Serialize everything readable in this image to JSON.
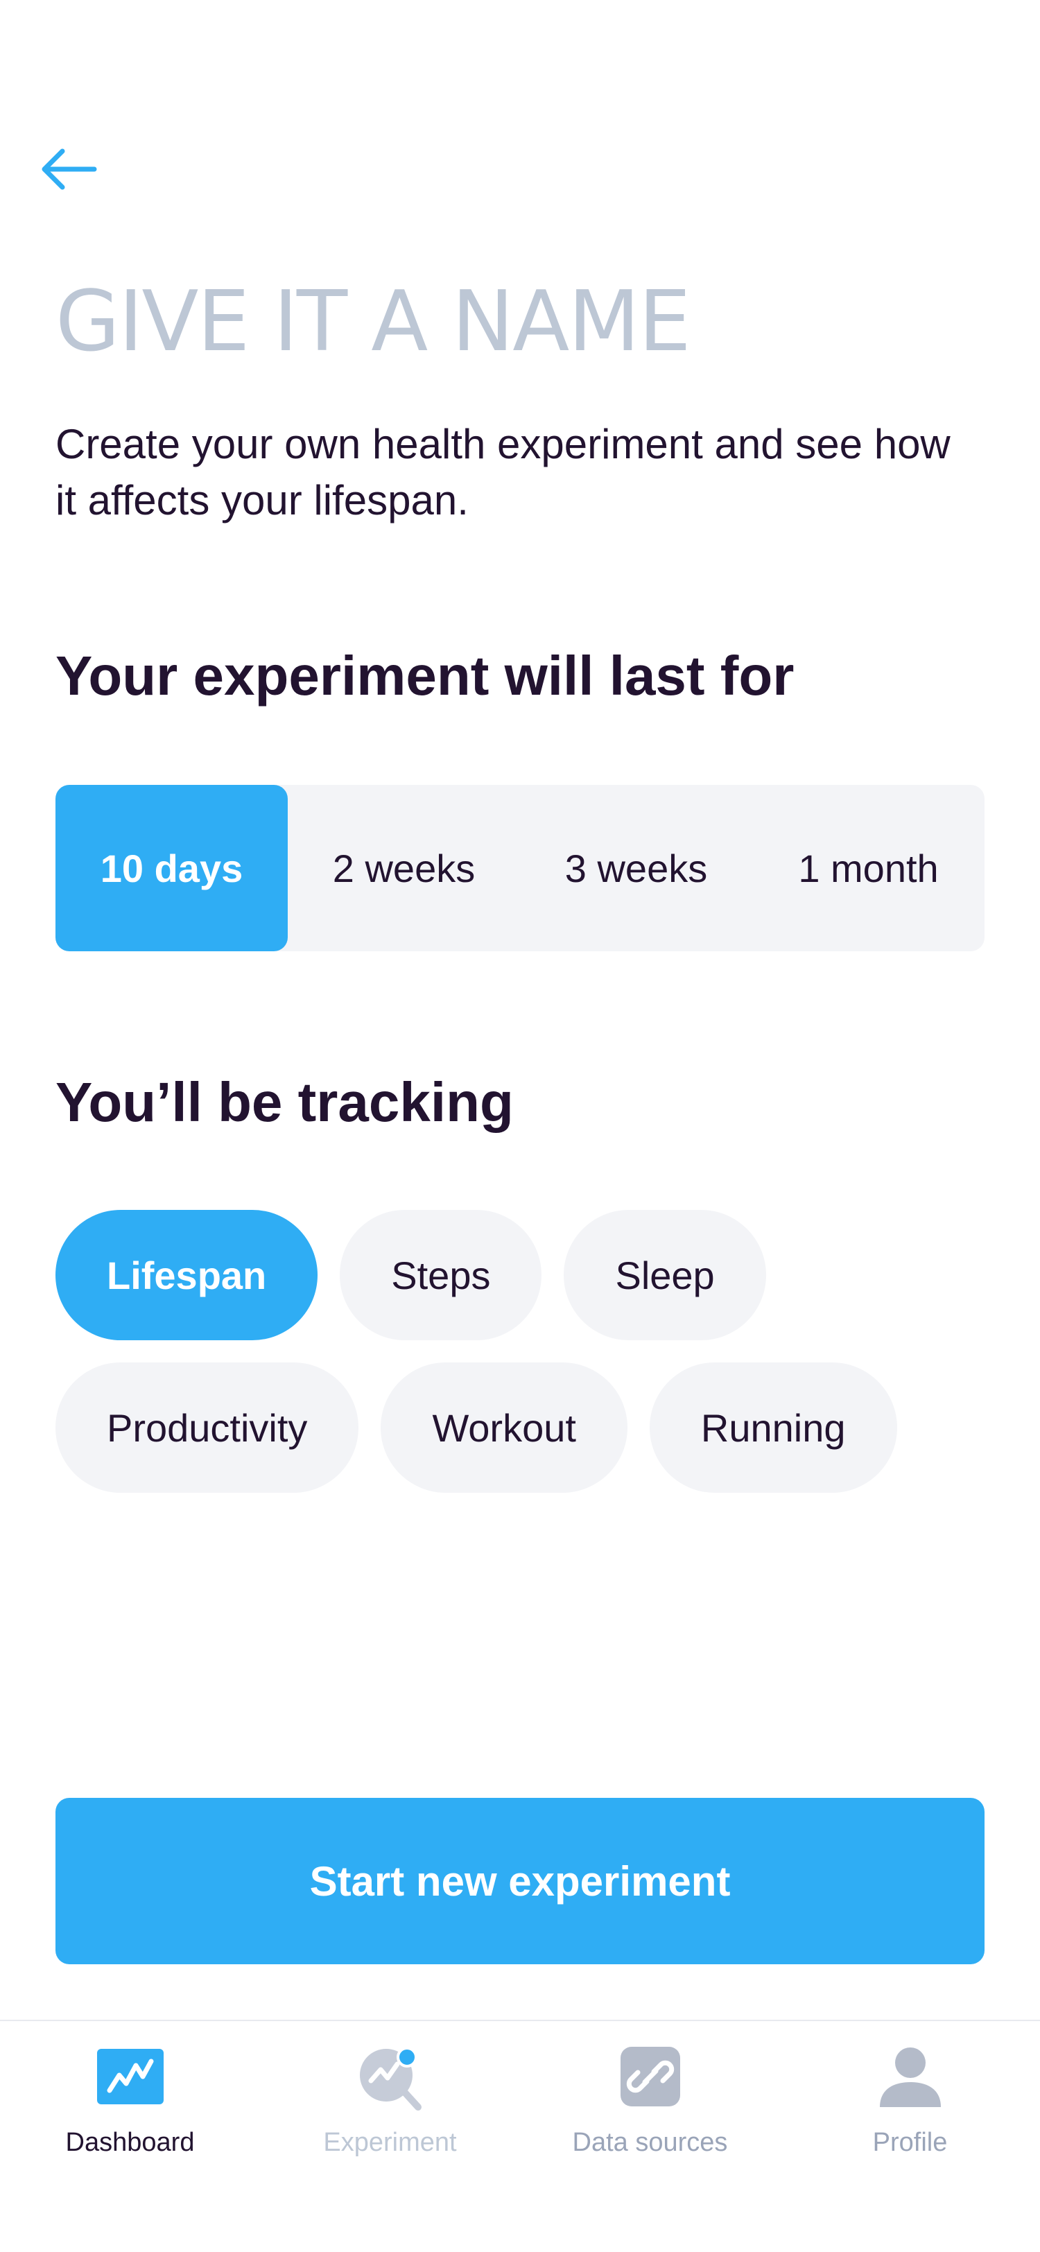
{
  "header": {
    "title": "GIVE IT A NAME",
    "subtitle": "Create your own health experiment and see how it affects your lifespan."
  },
  "duration": {
    "heading": "Your experiment will last for",
    "options": [
      "10 days",
      "2 weeks",
      "3 weeks",
      "1 month"
    ],
    "selected": "10 days"
  },
  "tracking": {
    "heading": "You’ll be tracking",
    "options": [
      "Lifespan",
      "Steps",
      "Sleep",
      "Productivity",
      "Workout",
      "Running"
    ],
    "selected": "Lifespan"
  },
  "actions": {
    "start_label": "Start new experiment"
  },
  "tabbar": {
    "items": [
      {
        "label": "Dashboard",
        "icon": "dashboard-icon",
        "state": "active"
      },
      {
        "label": "Experiment",
        "icon": "experiment-icon",
        "state": "dimmed"
      },
      {
        "label": "Data sources",
        "icon": "link-icon",
        "state": "inactive"
      },
      {
        "label": "Profile",
        "icon": "profile-icon",
        "state": "inactive"
      }
    ]
  },
  "colors": {
    "accent": "#2FADF4",
    "text_primary": "#221330",
    "title_muted": "#BDC7D5",
    "chip_background": "#F3F4F7",
    "icon_gray": "#B4BBC9"
  }
}
